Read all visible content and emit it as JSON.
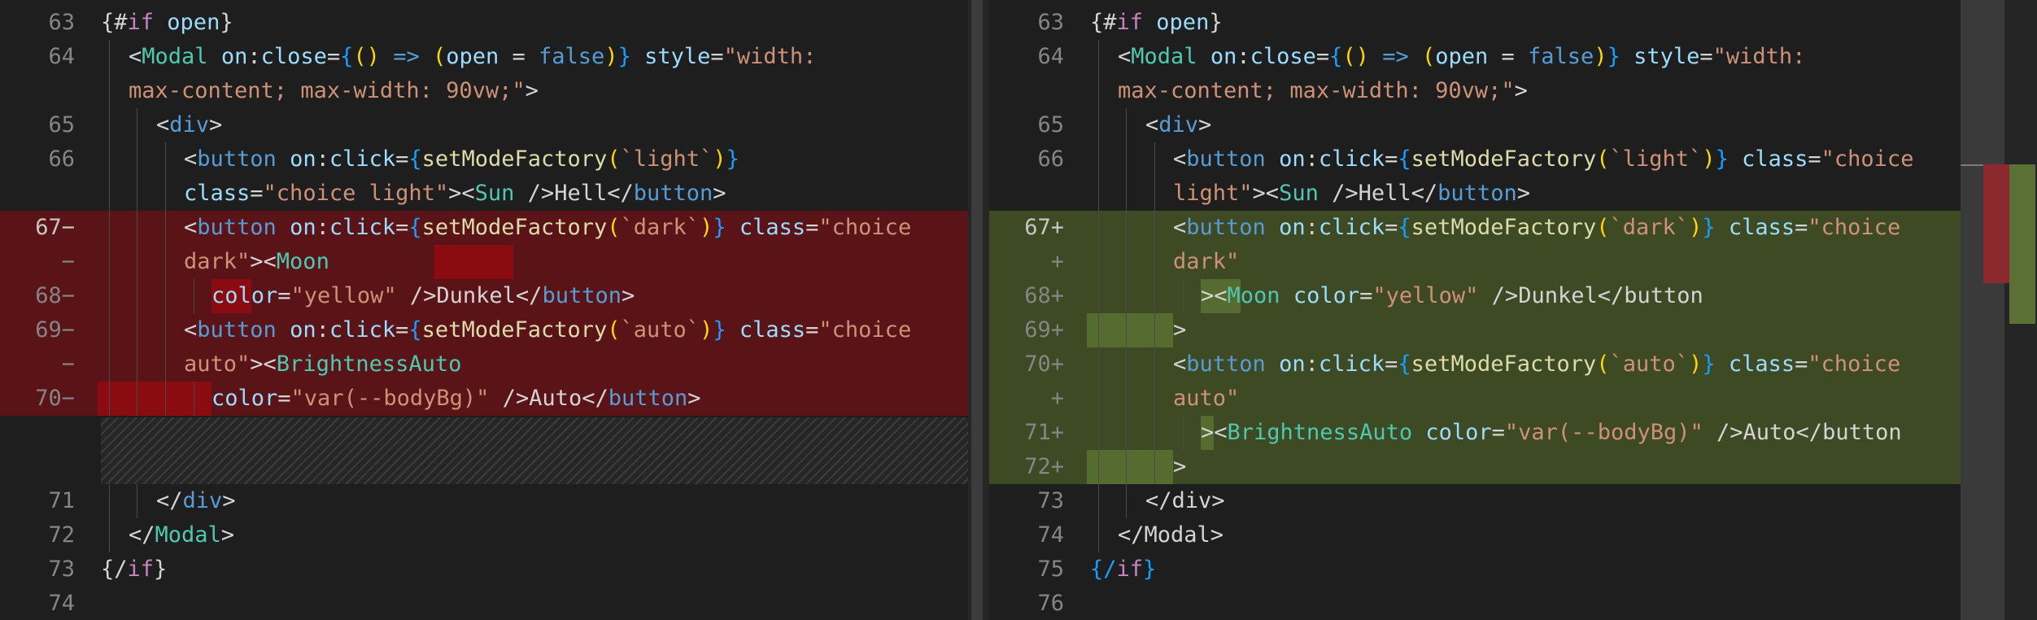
{
  "left": {
    "gutter": [
      "63",
      "64",
      "",
      "65",
      "66",
      "",
      "67−",
      "−",
      "68−",
      "69−",
      "−",
      "70−",
      "",
      "",
      "71",
      "72",
      "73",
      "74"
    ],
    "lines": [
      [
        [
          "{#",
          "t-punc"
        ],
        [
          "if",
          "t-kw"
        ],
        [
          " ",
          "t-plain"
        ],
        [
          "open",
          "t-var"
        ],
        [
          "}",
          "t-punc"
        ]
      ],
      [
        [
          "<",
          "t-punc"
        ],
        [
          "Modal",
          "t-tag"
        ],
        [
          " ",
          "t-plain"
        ],
        [
          "on",
          "t-attr"
        ],
        [
          ":",
          "t-punc"
        ],
        [
          "close",
          "t-attr"
        ],
        [
          "=",
          "t-punc"
        ],
        [
          "{",
          "t-brace"
        ],
        [
          "() ",
          "t-bk"
        ],
        [
          "=>",
          "t-bool"
        ],
        [
          " (",
          "t-bk"
        ],
        [
          "open",
          "t-var"
        ],
        [
          " = ",
          "t-plain"
        ],
        [
          "false",
          "t-bool"
        ],
        [
          ")",
          "t-bk"
        ],
        [
          "}",
          "t-brace"
        ],
        [
          " ",
          "t-plain"
        ],
        [
          "style",
          "t-attr"
        ],
        [
          "=",
          "t-punc"
        ],
        [
          "\"width:",
          "t-str"
        ]
      ],
      [
        [
          "max-content; max-width: 90vw;\"",
          "t-str"
        ],
        [
          ">",
          "t-punc"
        ]
      ],
      [
        [
          "<",
          "t-punc"
        ],
        [
          "div",
          "t-html"
        ],
        [
          ">",
          "t-punc"
        ]
      ],
      [
        [
          "<",
          "t-punc"
        ],
        [
          "button",
          "t-html"
        ],
        [
          " ",
          "t-plain"
        ],
        [
          "on",
          "t-attr"
        ],
        [
          ":",
          "t-punc"
        ],
        [
          "click",
          "t-attr"
        ],
        [
          "=",
          "t-punc"
        ],
        [
          "{",
          "t-brace"
        ],
        [
          "setModeFactory",
          "t-fn"
        ],
        [
          "(",
          "t-bk"
        ],
        [
          "`light`",
          "t-str"
        ],
        [
          ")",
          "t-bk"
        ],
        [
          "}",
          "t-brace"
        ]
      ],
      [
        [
          "class",
          "t-attr"
        ],
        [
          "=",
          "t-punc"
        ],
        [
          "\"choice light\"",
          "t-str"
        ],
        [
          "><",
          "t-punc"
        ],
        [
          "Sun",
          "t-tag"
        ],
        [
          " />",
          "t-punc"
        ],
        [
          "Hell",
          "t-plain"
        ],
        [
          "</",
          "t-punc"
        ],
        [
          "button",
          "t-html"
        ],
        [
          ">",
          "t-punc"
        ]
      ],
      [
        [
          "<",
          "t-punc"
        ],
        [
          "button",
          "t-html"
        ],
        [
          " ",
          "t-plain"
        ],
        [
          "on",
          "t-attr"
        ],
        [
          ":",
          "t-punc"
        ],
        [
          "click",
          "t-attr"
        ],
        [
          "=",
          "t-punc"
        ],
        [
          "{",
          "t-brace"
        ],
        [
          "setModeFactory",
          "t-fn"
        ],
        [
          "(",
          "t-bk"
        ],
        [
          "`dark`",
          "t-str"
        ],
        [
          ")",
          "t-bk"
        ],
        [
          "}",
          "t-brace"
        ],
        [
          " ",
          "t-plain"
        ],
        [
          "class",
          "t-attr"
        ],
        [
          "=",
          "t-punc"
        ],
        [
          "\"choice",
          "t-str"
        ]
      ],
      [
        [
          "dark\"",
          "t-str"
        ],
        [
          "><",
          "t-punc"
        ],
        [
          "Moon",
          "t-tag"
        ]
      ],
      [
        [
          "color",
          "t-attr"
        ],
        [
          "=",
          "t-punc"
        ],
        [
          "\"yellow\"",
          "t-str"
        ],
        [
          " />",
          "t-punc"
        ],
        [
          "Dunkel",
          "t-plain"
        ],
        [
          "</",
          "t-punc"
        ],
        [
          "button",
          "t-html"
        ],
        [
          ">",
          "t-punc"
        ]
      ],
      [
        [
          "<",
          "t-punc"
        ],
        [
          "button",
          "t-html"
        ],
        [
          " ",
          "t-plain"
        ],
        [
          "on",
          "t-attr"
        ],
        [
          ":",
          "t-punc"
        ],
        [
          "click",
          "t-attr"
        ],
        [
          "=",
          "t-punc"
        ],
        [
          "{",
          "t-brace"
        ],
        [
          "setModeFactory",
          "t-fn"
        ],
        [
          "(",
          "t-bk"
        ],
        [
          "`auto`",
          "t-str"
        ],
        [
          ")",
          "t-bk"
        ],
        [
          "}",
          "t-brace"
        ],
        [
          " ",
          "t-plain"
        ],
        [
          "class",
          "t-attr"
        ],
        [
          "=",
          "t-punc"
        ],
        [
          "\"choice",
          "t-str"
        ]
      ],
      [
        [
          "auto\"",
          "t-str"
        ],
        [
          "><",
          "t-punc"
        ],
        [
          "BrightnessAuto",
          "t-tag"
        ]
      ],
      [
        [
          "color",
          "t-attr"
        ],
        [
          "=",
          "t-punc"
        ],
        [
          "\"var(--bodyBg)\"",
          "t-str"
        ],
        [
          " />",
          "t-punc"
        ],
        [
          "Auto",
          "t-plain"
        ],
        [
          "</",
          "t-punc"
        ],
        [
          "button",
          "t-html"
        ],
        [
          ">",
          "t-punc"
        ]
      ],
      [],
      [],
      [
        [
          "</",
          "t-punc"
        ],
        [
          "div",
          "t-html"
        ],
        [
          ">",
          "t-punc"
        ]
      ],
      [
        [
          "</",
          "t-punc"
        ],
        [
          "Modal",
          "t-tag"
        ],
        [
          ">",
          "t-punc"
        ]
      ],
      [
        [
          "{/",
          "t-punc"
        ],
        [
          "if",
          "t-kw"
        ],
        [
          "}",
          "t-punc"
        ]
      ],
      []
    ]
  },
  "right": {
    "gutter": [
      "63",
      "64",
      "",
      "65",
      "66",
      "",
      "67+",
      "+",
      "68+",
      "69+",
      "70+",
      "+",
      "71+",
      "72+",
      "73",
      "74",
      "75",
      "76"
    ],
    "lines": [
      [
        [
          "{#",
          "t-punc"
        ],
        [
          "if",
          "t-kw"
        ],
        [
          " ",
          "t-plain"
        ],
        [
          "open",
          "t-var"
        ],
        [
          "}",
          "t-punc"
        ]
      ],
      [
        [
          "<",
          "t-punc"
        ],
        [
          "Modal",
          "t-tag"
        ],
        [
          " ",
          "t-plain"
        ],
        [
          "on",
          "t-attr"
        ],
        [
          ":",
          "t-punc"
        ],
        [
          "close",
          "t-attr"
        ],
        [
          "=",
          "t-punc"
        ],
        [
          "{",
          "t-brace"
        ],
        [
          "() ",
          "t-bk"
        ],
        [
          "=>",
          "t-bool"
        ],
        [
          " (",
          "t-bk"
        ],
        [
          "open",
          "t-var"
        ],
        [
          " = ",
          "t-plain"
        ],
        [
          "false",
          "t-bool"
        ],
        [
          ")",
          "t-bk"
        ],
        [
          "}",
          "t-brace"
        ],
        [
          " ",
          "t-plain"
        ],
        [
          "style",
          "t-attr"
        ],
        [
          "=",
          "t-punc"
        ],
        [
          "\"width:",
          "t-str"
        ]
      ],
      [
        [
          "max-content; max-width: 90vw;\"",
          "t-str"
        ],
        [
          ">",
          "t-punc"
        ]
      ],
      [
        [
          "<",
          "t-punc"
        ],
        [
          "div",
          "t-html"
        ],
        [
          ">",
          "t-punc"
        ]
      ],
      [
        [
          "<",
          "t-punc"
        ],
        [
          "button",
          "t-html"
        ],
        [
          " ",
          "t-plain"
        ],
        [
          "on",
          "t-attr"
        ],
        [
          ":",
          "t-punc"
        ],
        [
          "click",
          "t-attr"
        ],
        [
          "=",
          "t-punc"
        ],
        [
          "{",
          "t-brace"
        ],
        [
          "setModeFactory",
          "t-fn"
        ],
        [
          "(",
          "t-bk"
        ],
        [
          "`light`",
          "t-str"
        ],
        [
          ")",
          "t-bk"
        ],
        [
          "}",
          "t-brace"
        ],
        [
          " ",
          "t-plain"
        ],
        [
          "class",
          "t-attr"
        ],
        [
          "=",
          "t-punc"
        ],
        [
          "\"choice",
          "t-str"
        ]
      ],
      [
        [
          "light\"",
          "t-str"
        ],
        [
          "><",
          "t-punc"
        ],
        [
          "Sun",
          "t-tag"
        ],
        [
          " />",
          "t-punc"
        ],
        [
          "Hell",
          "t-plain"
        ],
        [
          "</",
          "t-punc"
        ],
        [
          "button",
          "t-html"
        ],
        [
          ">",
          "t-punc"
        ]
      ],
      [
        [
          "<",
          "t-punc"
        ],
        [
          "button",
          "t-html"
        ],
        [
          " ",
          "t-plain"
        ],
        [
          "on",
          "t-attr"
        ],
        [
          ":",
          "t-punc"
        ],
        [
          "click",
          "t-attr"
        ],
        [
          "=",
          "t-punc"
        ],
        [
          "{",
          "t-brace"
        ],
        [
          "setModeFactory",
          "t-fn"
        ],
        [
          "(",
          "t-bk"
        ],
        [
          "`dark`",
          "t-str"
        ],
        [
          ")",
          "t-bk"
        ],
        [
          "}",
          "t-brace"
        ],
        [
          " ",
          "t-plain"
        ],
        [
          "class",
          "t-attr"
        ],
        [
          "=",
          "t-punc"
        ],
        [
          "\"choice",
          "t-str"
        ]
      ],
      [
        [
          "dark\"",
          "t-str"
        ]
      ],
      [
        [
          "><",
          "t-punc"
        ],
        [
          "Moon",
          "t-tag"
        ],
        [
          " ",
          "t-plain"
        ],
        [
          "color",
          "t-attr"
        ],
        [
          "=",
          "t-punc"
        ],
        [
          "\"yellow\"",
          "t-str"
        ],
        [
          " />",
          "t-punc"
        ],
        [
          "Dunkel</button",
          "t-plain"
        ]
      ],
      [
        [
          ">",
          "t-plain"
        ]
      ],
      [
        [
          "<",
          "t-punc"
        ],
        [
          "button",
          "t-html"
        ],
        [
          " ",
          "t-plain"
        ],
        [
          "on",
          "t-attr"
        ],
        [
          ":",
          "t-punc"
        ],
        [
          "click",
          "t-attr"
        ],
        [
          "=",
          "t-punc"
        ],
        [
          "{",
          "t-brace"
        ],
        [
          "setModeFactory",
          "t-fn"
        ],
        [
          "(",
          "t-bk"
        ],
        [
          "`auto`",
          "t-str"
        ],
        [
          ")",
          "t-bk"
        ],
        [
          "}",
          "t-brace"
        ],
        [
          " ",
          "t-plain"
        ],
        [
          "class",
          "t-attr"
        ],
        [
          "=",
          "t-punc"
        ],
        [
          "\"choice",
          "t-str"
        ]
      ],
      [
        [
          "auto\"",
          "t-str"
        ]
      ],
      [
        [
          "><",
          "t-punc"
        ],
        [
          "BrightnessAuto",
          "t-tag"
        ],
        [
          " ",
          "t-plain"
        ],
        [
          "color",
          "t-attr"
        ],
        [
          "=",
          "t-punc"
        ],
        [
          "\"var(--bodyBg)\"",
          "t-str"
        ],
        [
          " />",
          "t-punc"
        ],
        [
          "Auto</button",
          "t-plain"
        ]
      ],
      [
        [
          ">",
          "t-plain"
        ]
      ],
      [
        [
          "</div>",
          "t-plain"
        ]
      ],
      [
        [
          "</Modal>",
          "t-plain"
        ]
      ],
      [
        [
          "{/",
          "t-brace"
        ],
        [
          "if",
          "t-kw"
        ],
        [
          "}",
          "t-brace"
        ]
      ],
      []
    ]
  },
  "colors": {
    "removed_bg": "#5a1417",
    "removed_highlight": "#8b0c10",
    "added_bg": "#3d4a24",
    "added_highlight": "#566b30"
  }
}
